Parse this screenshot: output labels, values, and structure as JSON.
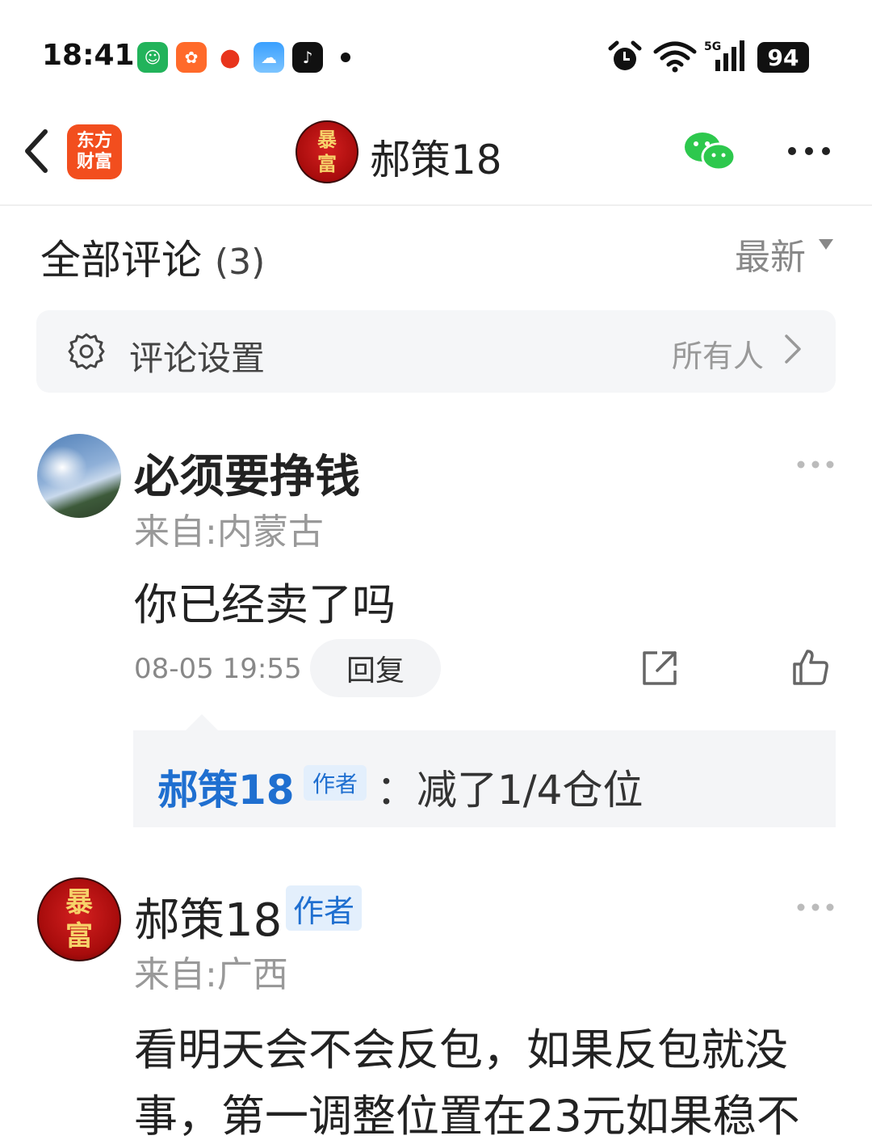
{
  "status_bar": {
    "time": "18:41",
    "battery": "94",
    "icons": [
      "app-green-icon",
      "app-orange-icon",
      "app-red-icon",
      "weather-icon",
      "tiktok-icon",
      "alarm-icon",
      "wifi-icon",
      "signal-5g-icon"
    ]
  },
  "header": {
    "brand_line1": "东方",
    "brand_line2": "财富",
    "avatar_line1": "暴",
    "avatar_line2": "富",
    "name": "郝策18"
  },
  "comments_section": {
    "title": "全部评论",
    "count": "(3)",
    "sort_label": "最新"
  },
  "settings": {
    "label": "评论设置",
    "value": "所有人"
  },
  "comments": [
    {
      "user": "必须要挣钱",
      "location": "来自:内蒙古",
      "text": "你已经卖了吗",
      "time": "08-05 19:55",
      "reply_label": "回复",
      "reply": {
        "author": "郝策18",
        "tag": "作者",
        "text": "：减了1/4仓位"
      }
    },
    {
      "user": "郝策18",
      "tag": "作者",
      "avatar_line1": "暴",
      "avatar_line2": "富",
      "location": "来自:广西",
      "text_line1": "看明天会不会反包，如果反包就没",
      "text_line2": "事，第一调整位置在23元如果稳不"
    }
  ],
  "colors": {
    "accent_blue": "#1f6fd0",
    "brand_orange": "#f24e1e",
    "wechat_green": "#2dc84d"
  }
}
